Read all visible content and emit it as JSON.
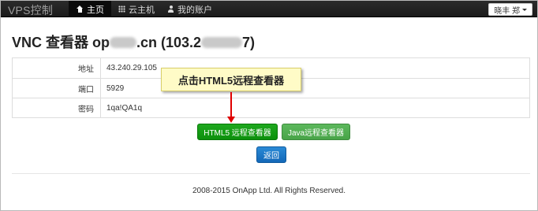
{
  "navbar": {
    "brand": "VPS控制",
    "items": [
      {
        "label": "主页",
        "icon": "home-icon",
        "active": true
      },
      {
        "label": "云主机",
        "icon": "grid-icon",
        "active": false
      },
      {
        "label": "我的账户",
        "icon": "user-icon",
        "active": false
      }
    ],
    "user_menu": "晓丰 郑"
  },
  "page": {
    "title_prefix": "VNC 查看器 op",
    "title_middle": ".cn (103.2",
    "title_suffix": "7)"
  },
  "info": {
    "rows": [
      {
        "label": "地址",
        "value": "43.240.29.105"
      },
      {
        "label": "端口",
        "value": "5929"
      },
      {
        "label": "密码",
        "value": "1qa!QA1q"
      }
    ]
  },
  "callout": {
    "text": "点击HTML5远程查看器"
  },
  "buttons": {
    "html5_viewer": "HTML5 远程查看器",
    "java_viewer": "Java远程查看器",
    "back": "返回"
  },
  "footer": {
    "text": "2008-2015 OnApp Ltd. All Rights Reserved."
  },
  "colors": {
    "navbar": "#222222",
    "primary_green": "#119a11",
    "secondary_green": "#5cb85c",
    "blue": "#1a75c7",
    "arrow": "#e00000",
    "callout_bg": "#fffbc7"
  }
}
